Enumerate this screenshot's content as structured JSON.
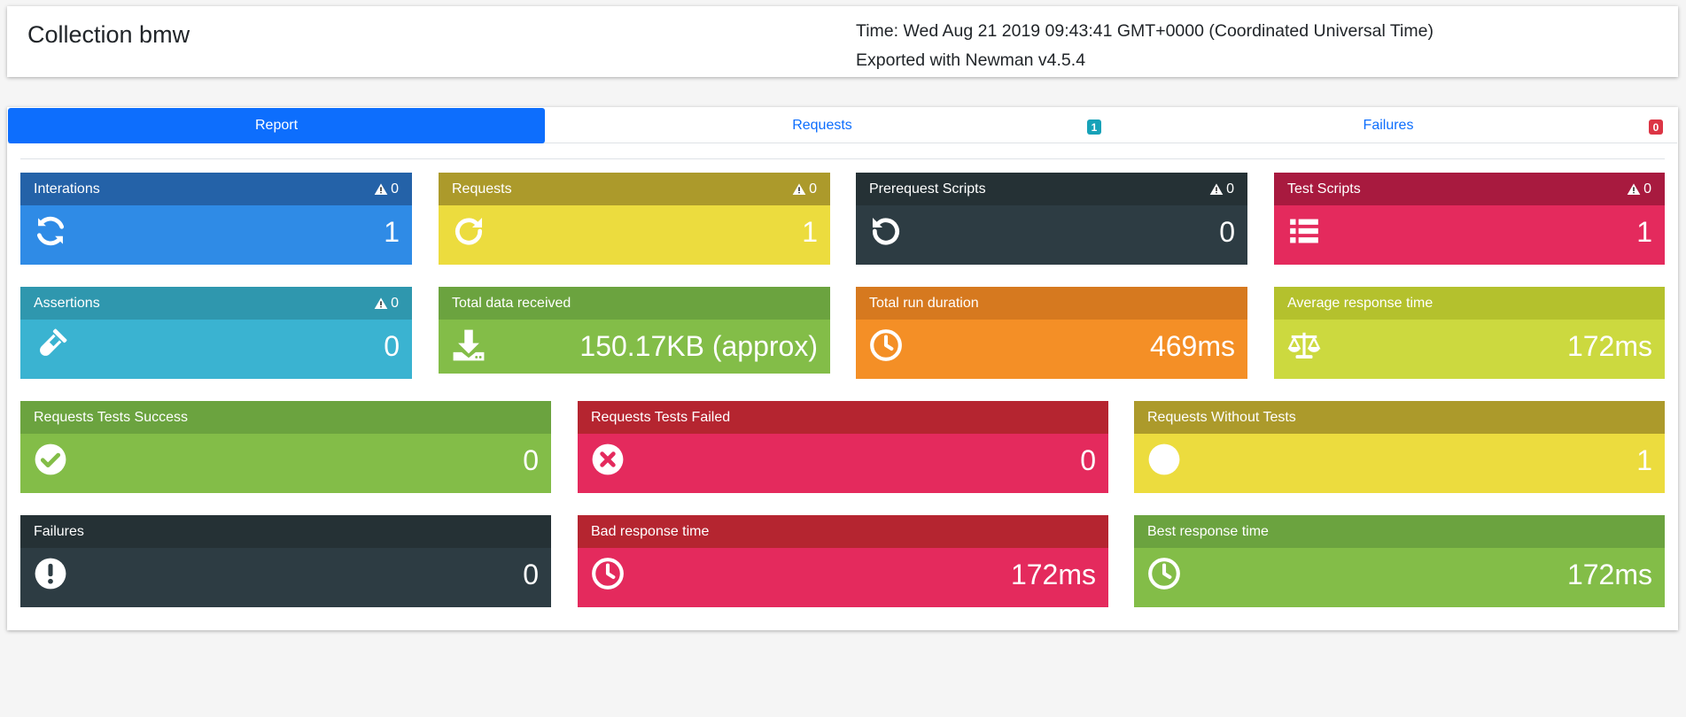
{
  "header": {
    "title": "Collection bmw",
    "time": "Time: Wed Aug 21 2019 09:43:41 GMT+0000 (Coordinated Universal Time)",
    "exported": "Exported with Newman v4.5.4"
  },
  "tabs": [
    {
      "label": "Report",
      "active": true
    },
    {
      "label": "Requests",
      "badge": "1",
      "badge_color": "#17a2b8"
    },
    {
      "label": "Failures",
      "badge": "0",
      "badge_color": "#dc3545"
    }
  ],
  "tiles": [
    {
      "label": "Interations",
      "warn": "0",
      "value": "1",
      "icon": "sync-icon",
      "head_color": "#2462a8",
      "body_color": "#2f8be6"
    },
    {
      "label": "Requests",
      "warn": "0",
      "value": "1",
      "icon": "redo-icon",
      "head_color": "#ac9a2b",
      "body_color": "#ecdc3e"
    },
    {
      "label": "Prerequest Scripts",
      "warn": "0",
      "value": "0",
      "icon": "undo-icon",
      "head_color": "#253135",
      "body_color": "#2d3c43"
    },
    {
      "label": "Test Scripts",
      "warn": "0",
      "value": "1",
      "icon": "list-icon",
      "head_color": "#a81a3f",
      "body_color": "#e42a5d"
    },
    {
      "label": "Assertions",
      "warn": "0",
      "value": "0",
      "icon": "flask-icon",
      "head_color": "#2f97ae",
      "body_color": "#3ab3d1"
    },
    {
      "label": "Total data received",
      "value": "150.17KB (approx)",
      "icon": "download-icon",
      "head_color": "#6ba33f",
      "body_color": "#83bd48"
    },
    {
      "label": "Total run duration",
      "value": "469ms",
      "icon": "clock-icon",
      "head_color": "#d6791f",
      "body_color": "#f48f26"
    },
    {
      "label": "Average response time",
      "value": "172ms",
      "icon": "balance-scale-icon",
      "head_color": "#b4c12d",
      "body_color": "#ccd93f"
    },
    {
      "label": "Requests Tests Success",
      "value": "0",
      "icon": "check-circle-icon",
      "head_color": "#6ba33f",
      "body_color": "#83bd48"
    },
    {
      "label": "Requests Tests Failed",
      "value": "0",
      "icon": "times-circle-icon",
      "head_color": "#b52530",
      "body_color": "#e42a5d"
    },
    {
      "label": "Requests Without Tests",
      "value": "1",
      "icon": "circle-icon",
      "head_color": "#ac9a2b",
      "body_color": "#ecdc3e"
    },
    {
      "label": "Failures",
      "value": "0",
      "icon": "exclamation-circle-icon",
      "head_color": "#253135",
      "body_color": "#2d3c43"
    },
    {
      "label": "Bad response time",
      "value": "172ms",
      "icon": "clock-icon",
      "head_color": "#b52530",
      "body_color": "#e42a5d"
    },
    {
      "label": "Best response time",
      "value": "172ms",
      "icon": "clock-icon",
      "head_color": "#6ba33f",
      "body_color": "#83bd48"
    }
  ]
}
